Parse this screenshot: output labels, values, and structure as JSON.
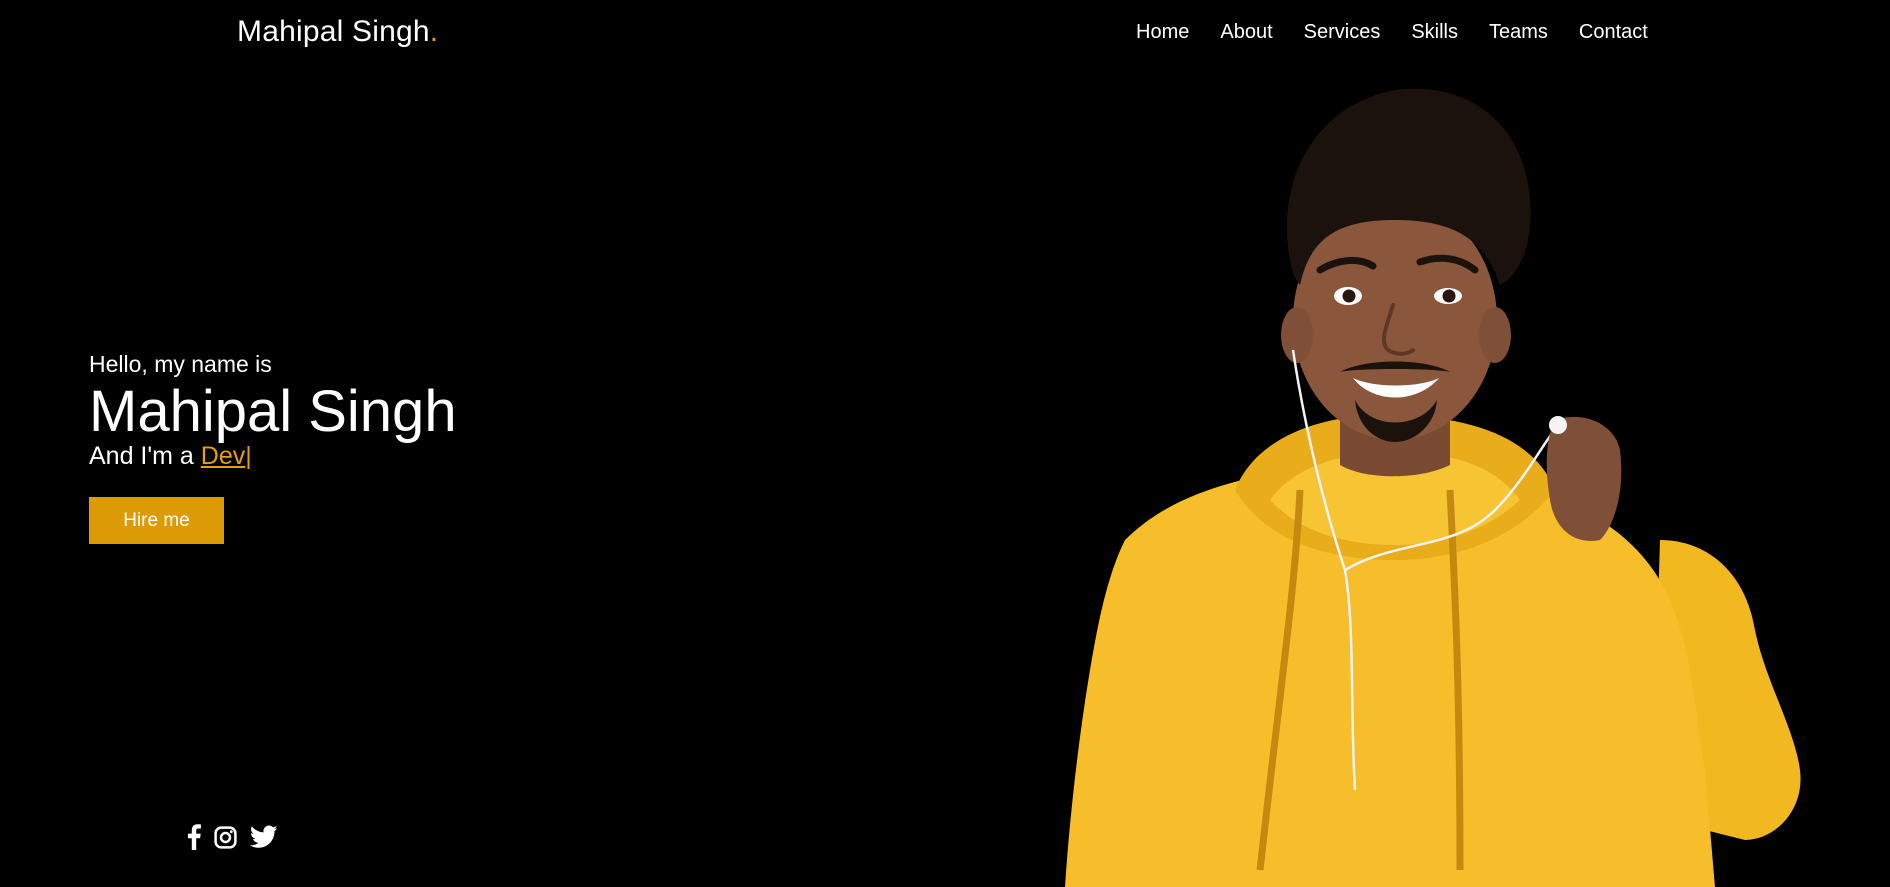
{
  "brand": {
    "name": "Mahipal Singh",
    "dot": "."
  },
  "nav": {
    "items": [
      "Home",
      "About",
      "Services",
      "Skills",
      "Teams",
      "Contact"
    ]
  },
  "hero": {
    "greeting": "Hello, my name is",
    "name": "Mahipal Singh",
    "role_prefix": "And I'm a ",
    "role_typed": "Dev",
    "cursor": "|",
    "cta": "Hire me"
  },
  "social": {
    "icons": [
      "facebook-icon",
      "instagram-icon",
      "twitter-icon"
    ]
  },
  "colors": {
    "background": "#000000",
    "accent": "#e2a00a",
    "button": "#dc9a05",
    "hoodie": "#f5be2a"
  }
}
